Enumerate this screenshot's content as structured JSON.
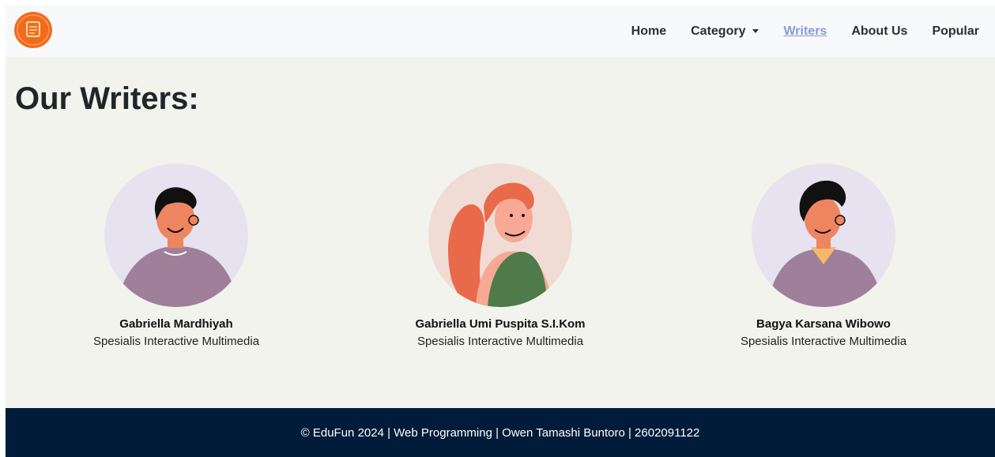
{
  "nav": {
    "brand_logo": "edufun-logo",
    "items": [
      {
        "label": "Home"
      },
      {
        "label": "Category"
      },
      {
        "label": "Writers",
        "active": true
      },
      {
        "label": "About Us"
      },
      {
        "label": "Popular"
      }
    ]
  },
  "page": {
    "title": "Our Writers:"
  },
  "writers": [
    {
      "name": "Gabriella Mardhiyah",
      "role": "Spesialis Interactive Multimedia"
    },
    {
      "name": "Gabriella Umi Puspita S.I.Kom",
      "role": "Spesialis Interactive Multimedia"
    },
    {
      "name": "Bagya Karsana Wibowo",
      "role": "Spesialis Interactive Multimedia"
    }
  ],
  "footer": {
    "text": "© EduFun 2024 | Web Programming | Owen Tamashi Buntoro | 2602091122"
  },
  "colors": {
    "background": "#f1f3ec",
    "navbar": "#f8f9fa",
    "footer": "#011b3a",
    "active_link": "#8a99d8",
    "logo": "#f26b1d"
  }
}
